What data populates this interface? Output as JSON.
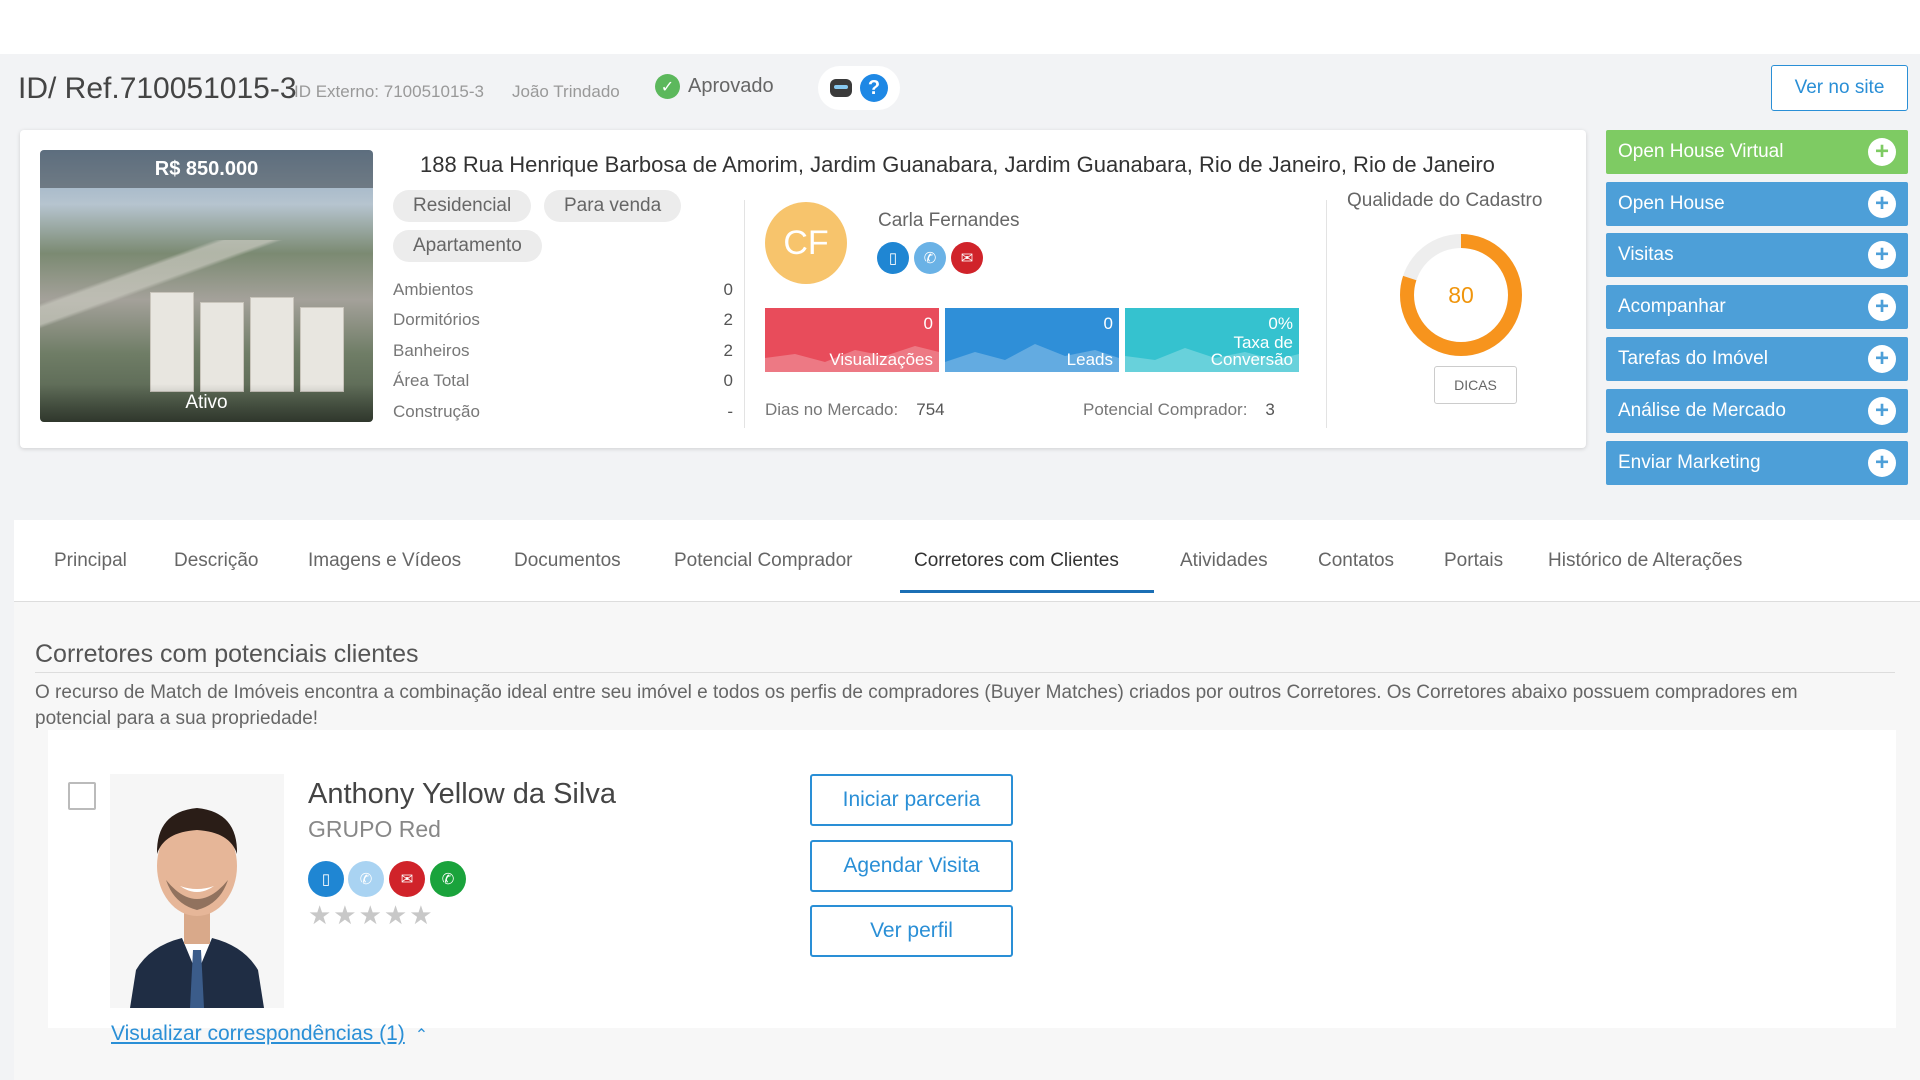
{
  "header": {
    "ref_title": "ID/ Ref.710051015-3",
    "external_id": "ID Externo: 710051015-3",
    "owner": "João Trindado",
    "status": "Aprovado",
    "view_site_label": "Ver no site"
  },
  "property": {
    "price": "R$ 850.000",
    "photo_status": "Ativo",
    "address": "188 Rua Henrique Barbosa de Amorim, Jardim Guanabara, Jardim Guanabara, Rio de Janeiro, Rio de Janeiro",
    "tags": [
      "Residencial",
      "Para venda",
      "Apartamento"
    ],
    "specs": [
      {
        "label": "Ambientos",
        "value": "0"
      },
      {
        "label": "Dormitórios",
        "value": "2"
      },
      {
        "label": "Banheiros",
        "value": "2"
      },
      {
        "label": "Área Total",
        "value": "0"
      },
      {
        "label": "Construção",
        "value": "-"
      }
    ]
  },
  "agent": {
    "initials": "CF",
    "name": "Carla Fernandes",
    "stats": [
      {
        "value": "0",
        "label": "Visualizações",
        "color": "#e84c5b"
      },
      {
        "value": "0",
        "label": "Leads",
        "color": "#2f8fd8"
      },
      {
        "value": "0%",
        "label": "Taxa de Conversão",
        "color": "#35c2cf"
      }
    ],
    "days_on_market_label": "Dias no Mercado:",
    "days_on_market_value": "754",
    "potential_buyer_label": "Potencial Comprador:",
    "potential_buyer_value": "3"
  },
  "quality": {
    "title": "Qualidade do Cadastro",
    "score": "80",
    "score_fraction": 0.8,
    "tips_label": "DICAS",
    "ring_color": "#f7941d"
  },
  "side_actions": [
    {
      "label": "Open House Virtual",
      "color": "#7ecb63"
    },
    {
      "label": "Open House",
      "color": "#4d9fd8"
    },
    {
      "label": "Visitas",
      "color": "#4d9fd8"
    },
    {
      "label": "Acompanhar",
      "color": "#4d9fd8"
    },
    {
      "label": "Tarefas do Imóvel",
      "color": "#4d9fd8"
    },
    {
      "label": "Análise de Mercado",
      "color": "#4d9fd8"
    },
    {
      "label": "Enviar Marketing",
      "color": "#4d9fd8"
    }
  ],
  "tabs": [
    {
      "label": "Principal"
    },
    {
      "label": "Descrição"
    },
    {
      "label": "Imagens e Vídeos"
    },
    {
      "label": "Documentos"
    },
    {
      "label": "Potencial Comprador"
    },
    {
      "label": "Corretores com Clientes",
      "active": true
    },
    {
      "label": "Atividades"
    },
    {
      "label": "Contatos"
    },
    {
      "label": "Portais"
    },
    {
      "label": "Histórico de Alterações"
    }
  ],
  "section": {
    "title": "Corretores com potenciais clientes",
    "description": "O recurso de Match de Imóveis encontra a combinação ideal entre seu imóvel e todos os perfis de compradores (Buyer Matches) criados por outros Corretores. Os Corretores abaixo possuem compradores em potencial para a sua propriedade!"
  },
  "broker": {
    "name": "Anthony Yellow da Silva",
    "group": "GRUPO Red",
    "rating": 0,
    "rating_max": 5,
    "actions": [
      "Iniciar parceria",
      "Agendar Visita",
      "Ver perfil"
    ],
    "matches_link": "Visualizar correspondências (1)"
  }
}
